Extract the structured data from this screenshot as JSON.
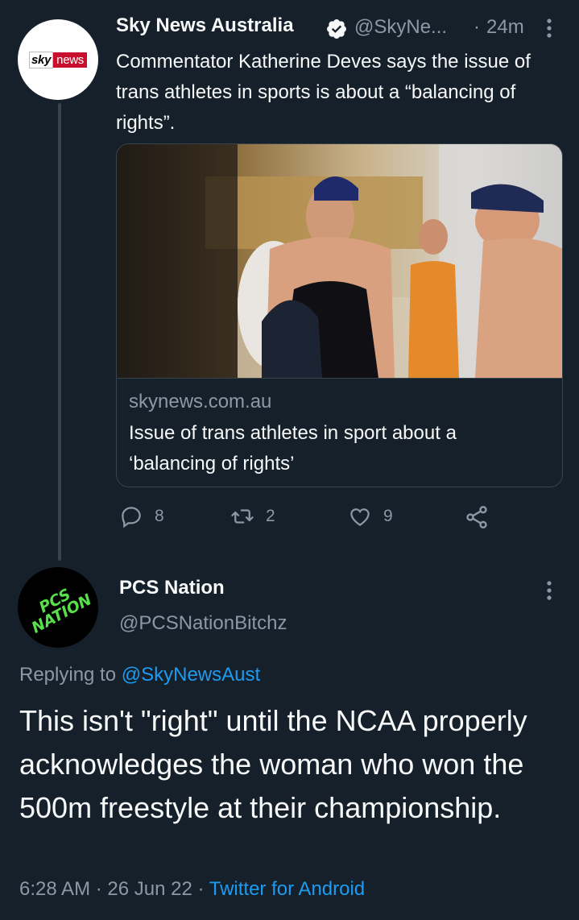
{
  "tweet": {
    "author_name": "Sky News Australia",
    "handle": "@SkyNe...",
    "separator": "·",
    "time": "24m",
    "text": "Commentator Katherine Deves says the issue of trans athletes in sports is about a “balancing of rights”.",
    "avatar_logo": {
      "left": "sky",
      "right": "news"
    },
    "link_card": {
      "domain": "skynews.com.au",
      "title": "Issue of trans athletes in sport about a ‘balancing of rights’"
    },
    "actions": {
      "replies": "8",
      "retweets": "2",
      "likes": "9"
    }
  },
  "reply": {
    "author_name": "PCS Nation",
    "handle": "@PCSNationBitchz",
    "avatar_logo": {
      "line1": "PCS",
      "line2": "NATION"
    },
    "replying_prefix": "Replying to",
    "replying_to": "@SkyNewsAust",
    "text": "This isn't \"right\" until the NCAA properly acknowledges the woman who won the 500m freestyle at their championship.",
    "time": "6:28 AM",
    "date": "26 Jun 22",
    "source": "Twitter for Android",
    "dot": "·"
  },
  "colors": {
    "background": "#15202b",
    "text": "#f7f9f9",
    "secondary_text": "#8b98a5",
    "accent": "#1d9bf0",
    "border": "#38444d"
  },
  "icons": [
    "verified-icon",
    "more-icon",
    "reply-icon",
    "retweet-icon",
    "like-icon",
    "share-icon"
  ]
}
